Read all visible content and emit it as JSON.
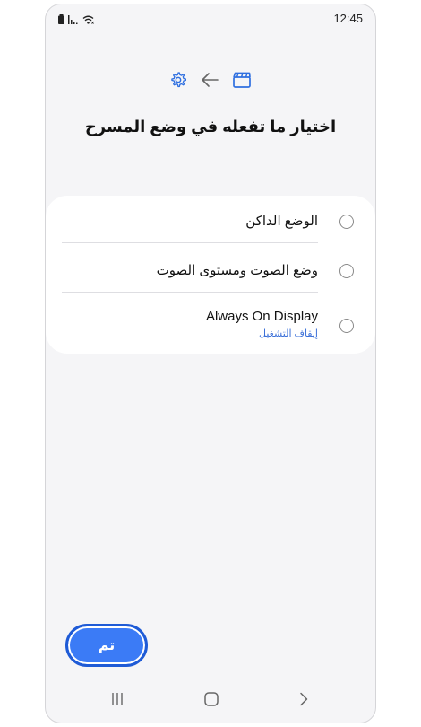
{
  "status_bar": {
    "time": "12:45",
    "icons": [
      "battery-icon",
      "signal-icon",
      "wifi-icon"
    ]
  },
  "header": {
    "icons": [
      "settings-icon",
      "arrow-left-icon",
      "clapperboard-icon"
    ],
    "title": "اختيار ما تفعله في وضع المسرح"
  },
  "options": [
    {
      "label": "الوضع الداكن",
      "sublabel": "",
      "selected": false
    },
    {
      "label": "وضع الصوت ومستوى الصوت",
      "sublabel": "",
      "selected": false
    },
    {
      "label": "Always On Display",
      "sublabel": "إيقاف التشغيل",
      "selected": false
    }
  ],
  "done_button": {
    "label": "تم"
  },
  "navigation": {
    "buttons": [
      "recent-apps-icon",
      "home-icon",
      "back-icon"
    ]
  },
  "colors": {
    "accent": "#3b7bf6",
    "accent_dark": "#1f5bd6",
    "sublabel": "#3a6fd8",
    "background": "#f5f5f7",
    "card": "#ffffff"
  }
}
